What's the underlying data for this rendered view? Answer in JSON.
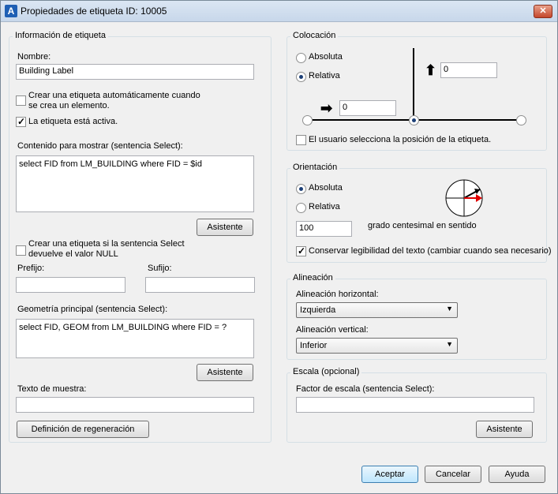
{
  "window": {
    "title": "Propiedades de etiqueta ID: 10005",
    "close": "✕"
  },
  "info": {
    "title": "Información de etiqueta",
    "nombre_label": "Nombre:",
    "nombre_value": "Building Label",
    "auto_create_line1": "Crear una etiqueta automáticamente cuando",
    "auto_create_line2": "se crea un elemento.",
    "active_label": "La etiqueta está activa.",
    "content_label": "Contenido para mostrar (sentencia Select):",
    "content_value": "select FID from LM_BUILDING where FID = $id",
    "wizard1": "Asistente",
    "null_line1": "Crear una etiqueta si la sentencia Select",
    "null_line2": "devuelve el valor NULL",
    "prefix_label": "Prefijo:",
    "suffix_label": "Sufijo:",
    "geom_label": "Geometría principal (sentencia Select):",
    "geom_value": "select FID, GEOM from LM_BUILDING where FID = ?",
    "wizard2": "Asistente",
    "sample_label": "Texto de muestra:",
    "regen_button": "Definición de regeneración"
  },
  "placement": {
    "title": "Colocación",
    "absolute": "Absoluta",
    "relative": "Relativa",
    "y_value": "0",
    "x_value": "0",
    "user_select": "El usuario selecciona la posición de la etiqueta."
  },
  "orientation": {
    "title": "Orientación",
    "absolute": "Absoluta",
    "relative": "Relativa",
    "value": "100",
    "units": "grado centesimal en sentido",
    "legibility": "Conservar legibilidad del texto (cambiar cuando sea necesario)"
  },
  "alignment": {
    "title": "Alineación",
    "h_label": "Alineación horizontal:",
    "h_value": "Izquierda",
    "v_label": "Alineación vertical:",
    "v_value": "Inferior"
  },
  "scale": {
    "title": "Escala (opcional)",
    "factor_label": "Factor de escala (sentencia Select):",
    "wizard": "Asistente"
  },
  "footer": {
    "ok": "Aceptar",
    "cancel": "Cancelar",
    "help": "Ayuda"
  }
}
